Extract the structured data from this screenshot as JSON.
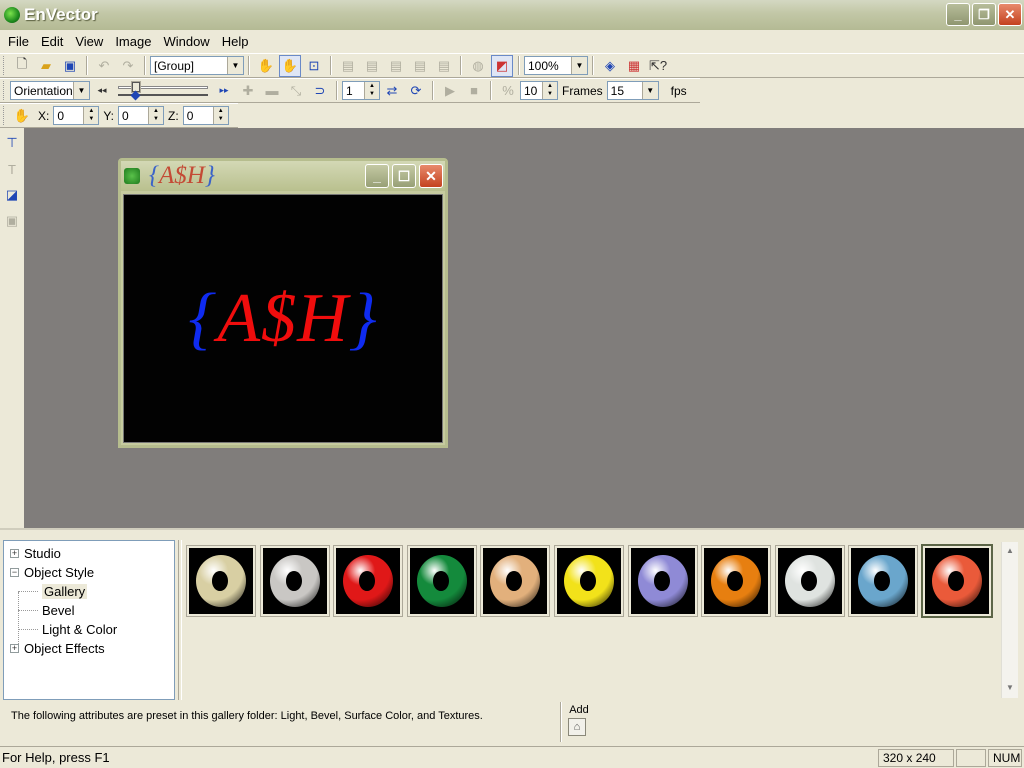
{
  "window": {
    "title": "EnVector"
  },
  "menu": [
    "File",
    "Edit",
    "View",
    "Image",
    "Window",
    "Help"
  ],
  "toolbar": {
    "group_select": "[Group]",
    "zoom": "100%",
    "mode_select": "Orientation",
    "frame_value": "1",
    "speed_value": "10",
    "frames_label": "Frames",
    "fps_value": "15",
    "fps_label": "fps",
    "x_label": "X:",
    "x_value": "0",
    "y_label": "Y:",
    "y_value": "0",
    "z_label": "Z:",
    "z_value": "0"
  },
  "document": {
    "title_brace_open": "{",
    "title_main": "A$H",
    "title_brace_close": "}",
    "canvas_brace_open": "{",
    "canvas_main": "A$H",
    "canvas_brace_close": "}",
    "canvas_colors": {
      "background": "#020202",
      "letters": "#f00d0d",
      "braces": "#0f2bf0"
    }
  },
  "tree": {
    "items": [
      {
        "label": "Studio",
        "expander": "+"
      },
      {
        "label": "Object Style",
        "expander": "−"
      },
      {
        "label": "Gallery"
      },
      {
        "label": "Bevel"
      },
      {
        "label": "Light & Color"
      },
      {
        "label": "Object Effects",
        "expander": "+"
      }
    ]
  },
  "gallery": {
    "swatches": [
      "#d8cfa3",
      "#c9c7c4",
      "#e01818",
      "#148a3c",
      "#e2b07c",
      "#f2e21a",
      "#8f8ad6",
      "#e77f10",
      "#dfe3e0",
      "#6aa6cc",
      "#ea5a3a"
    ],
    "selected_index": 10
  },
  "info": {
    "text": "The following attributes are preset in this gallery folder: Light, Bevel, Surface Color, and Textures.",
    "add_label": "Add"
  },
  "status": {
    "help": "For Help, press F1",
    "size": "320 x 240",
    "num": "NUM"
  }
}
